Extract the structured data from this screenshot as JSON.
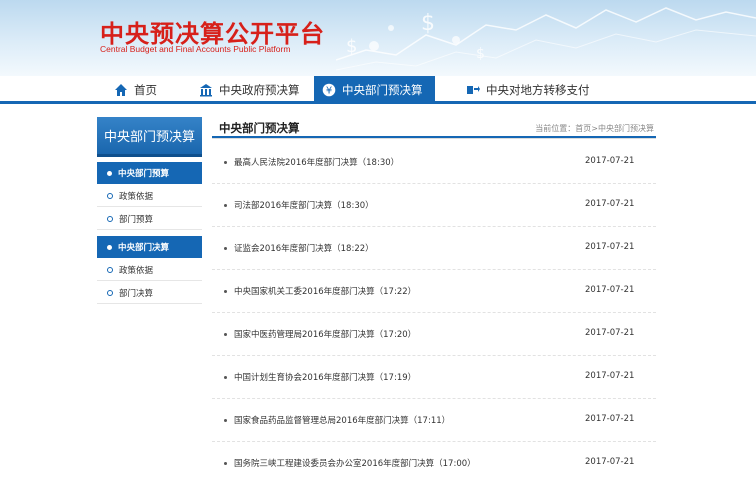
{
  "header": {
    "logo_cn": "中央预决算公开平台",
    "logo_en": "Central Budget and Final Accounts Public Platform"
  },
  "nav": {
    "items": [
      {
        "label": "首页",
        "icon": "home-icon"
      },
      {
        "label": "中央政府预决算",
        "icon": "building-icon"
      },
      {
        "label": "中央部门预决算",
        "icon": "yuan-coin-icon"
      },
      {
        "label": "中央对地方转移支付",
        "icon": "transfer-icon"
      }
    ],
    "active_index": 2
  },
  "sidebar": {
    "title": "中央部门预决算",
    "groups": [
      {
        "label": "中央部门预算",
        "items": [
          "政策依据",
          "部门预算"
        ]
      },
      {
        "label": "中央部门决算",
        "items": [
          "政策依据",
          "部门决算"
        ]
      }
    ]
  },
  "main": {
    "title": "中央部门预决算",
    "breadcrumb": "当前位置：首页>中央部门预决算",
    "rows": [
      {
        "text": "最高人民法院2016年度部门决算（18:30）",
        "date": "2017-07-21"
      },
      {
        "text": "司法部2016年度部门决算（18:30）",
        "date": "2017-07-21"
      },
      {
        "text": "证监会2016年度部门决算（18:22）",
        "date": "2017-07-21"
      },
      {
        "text": "中央国家机关工委2016年度部门决算（17:22）",
        "date": "2017-07-21"
      },
      {
        "text": "国家中医药管理局2016年度部门决算（17:20）",
        "date": "2017-07-21"
      },
      {
        "text": "中国计划生育协会2016年度部门决算（17:19）",
        "date": "2017-07-21"
      },
      {
        "text": "国家食品药品监督管理总局2016年度部门决算（17:11）",
        "date": "2017-07-21"
      },
      {
        "text": "国务院三峡工程建设委员会办公室2016年度部门决算（17:00）",
        "date": "2017-07-21"
      }
    ]
  },
  "colors": {
    "brand_red": "#d7201a",
    "nav_blue": "#1567b4"
  }
}
